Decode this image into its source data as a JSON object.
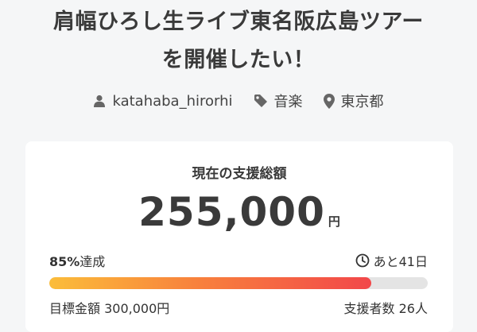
{
  "project": {
    "title_line1": "肩幅ひろし生ライブ東名阪広島ツアー",
    "title_line2": "を開催したい！",
    "owner": "katahaba_hirorhi",
    "category": "音楽",
    "location": "東京都"
  },
  "funding": {
    "label": "現在の支援総額",
    "amount": "255,000",
    "amount_unit": "円",
    "achievement_percent": "85%",
    "achievement_suffix": "達成",
    "progress": 0.85,
    "days_left": "あと41日",
    "goal_label": "目標金額",
    "goal_amount": "300,000円",
    "supporters_label": "支援者数",
    "supporters": "26人"
  },
  "colors": {
    "bar_start": "#fbbd3a",
    "bar_end": "#f2474a",
    "bar_track": "#e4e4e4",
    "icon_gray": "#666666"
  },
  "icons": [
    "user-icon",
    "tag-icon",
    "location-pin-icon",
    "clock-icon"
  ]
}
